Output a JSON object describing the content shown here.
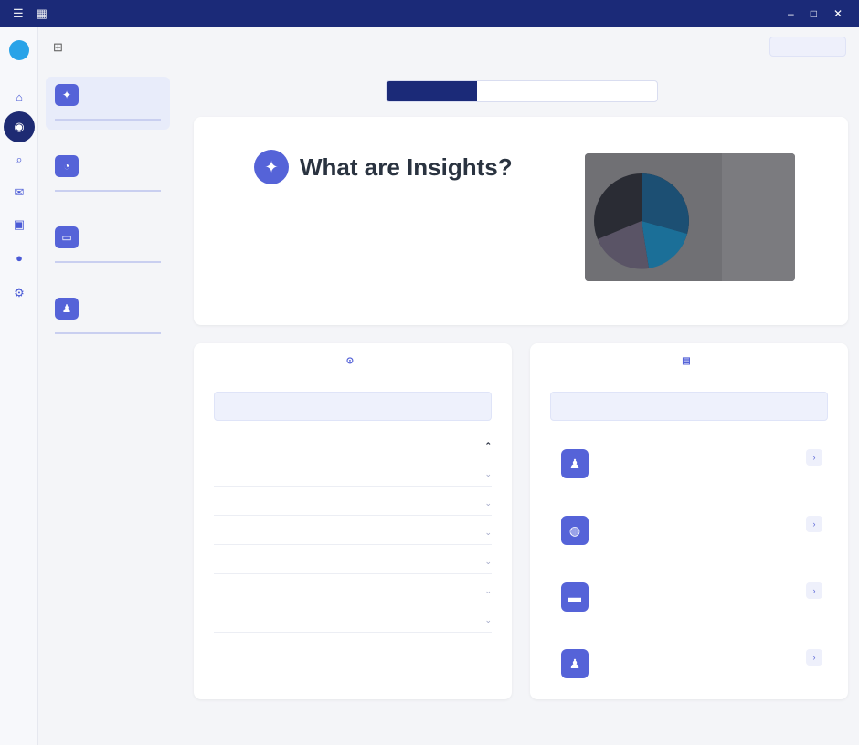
{
  "window": {
    "app_name": "",
    "title": "",
    "menu_icon": "☰",
    "app_icon": "grid-icon",
    "controls": [
      "–",
      "□",
      "✕"
    ]
  },
  "rail": {
    "items": [
      "home-icon",
      "insights-icon",
      "search-icon",
      "mail-icon",
      "chat-icon",
      "user-icon",
      "settings-icon"
    ]
  },
  "topbar": {
    "button_label": ""
  },
  "subnav": {
    "items": [
      {
        "label": "",
        "desc": ""
      },
      {
        "label": "",
        "desc": ""
      },
      {
        "label": "",
        "desc": ""
      },
      {
        "label": "",
        "desc": ""
      }
    ]
  },
  "tabs": [
    {
      "label": ""
    },
    {
      "label": ""
    },
    {
      "label": ""
    }
  ],
  "hero": {
    "title": "What are Insights?",
    "body": "",
    "image_desc": "pie-style chart screenshot"
  },
  "faq_card": {
    "title": "",
    "note": "",
    "topic_title": "",
    "topic_desc": "",
    "topic_link": "",
    "rows": [
      "",
      "",
      "",
      "",
      "",
      ""
    ]
  },
  "contact_card": {
    "title": "",
    "note": "",
    "items": [
      {
        "title": "",
        "desc": ""
      },
      {
        "title": "",
        "desc": ""
      },
      {
        "title": "",
        "desc": ""
      },
      {
        "title": "",
        "desc": ""
      }
    ]
  },
  "footer": {
    "text": ""
  },
  "colors": {
    "titlebar": "#1b2a78",
    "accent": "#5563d8",
    "link": "#5f6ad8",
    "background": "#f4f5f8"
  }
}
